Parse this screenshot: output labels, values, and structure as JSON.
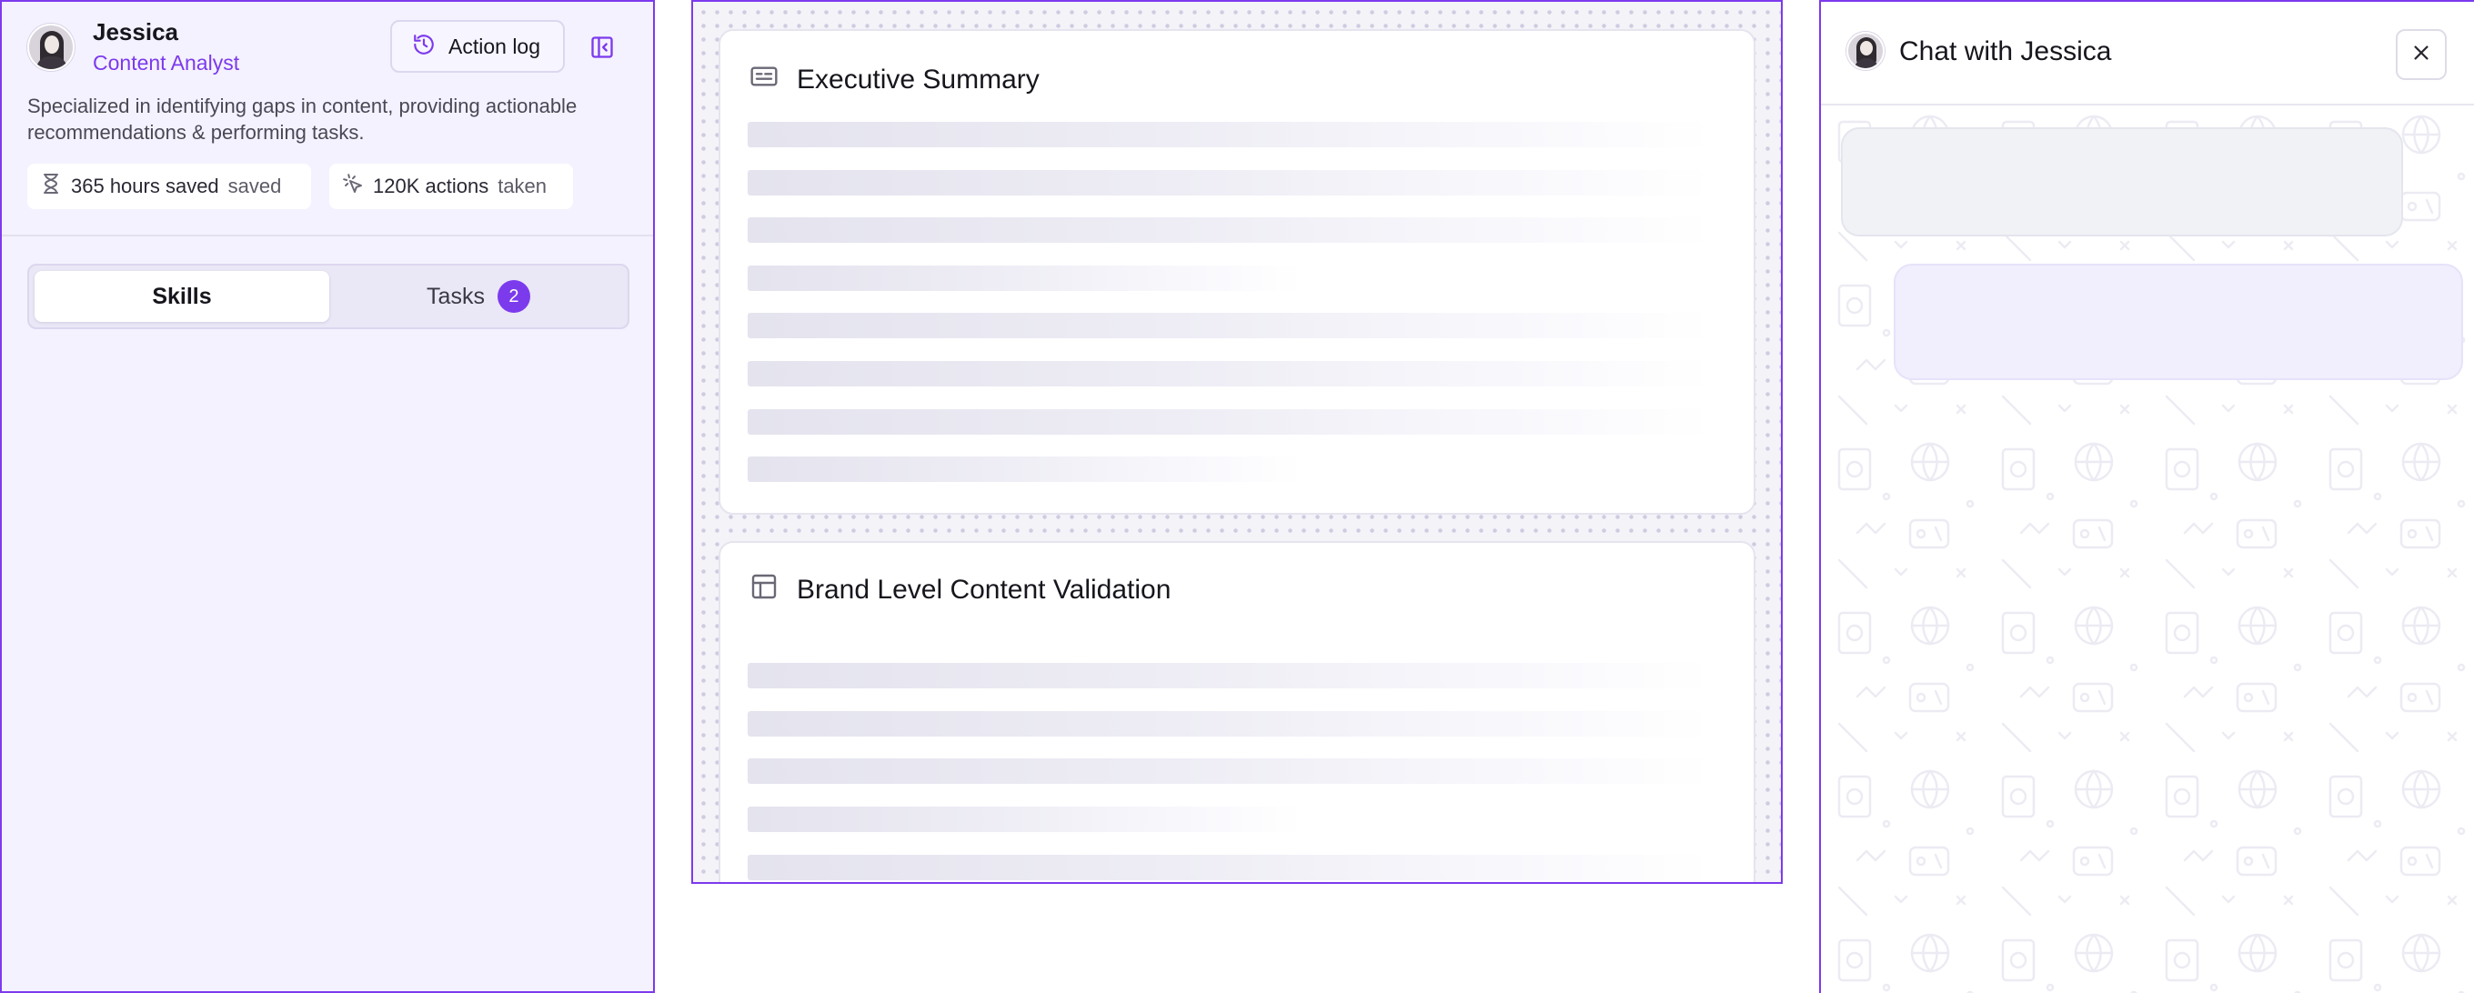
{
  "agent": {
    "name": "Jessica",
    "role": "Content Analyst",
    "description": "Specialized in identifying gaps in content, providing actionable recommendations & performing tasks.",
    "action_log_label": "Action log",
    "avatar_icon": "user-avatar",
    "stats": [
      {
        "value": "365 hours saved",
        "suffix": "saved",
        "icon": "hourglass-icon"
      },
      {
        "value": "120K actions",
        "suffix": "taken",
        "icon": "click-icon"
      }
    ]
  },
  "tabs": {
    "skills_label": "Skills",
    "tasks_label": "Tasks",
    "tasks_count": "2",
    "active": "Skills"
  },
  "report": {
    "cards": [
      {
        "title": "Executive Summary",
        "icon": "summary-card-icon",
        "loading": true
      },
      {
        "title": "Brand Level Content Validation",
        "icon": "table-layout-icon",
        "loading": true
      }
    ]
  },
  "chat": {
    "title": "Chat with Jessica",
    "close_icon": "close-icon"
  },
  "colors": {
    "accent": "#7c3aed",
    "panel_bg": "#f4f2fe",
    "skeleton": "#e4e3ee"
  }
}
